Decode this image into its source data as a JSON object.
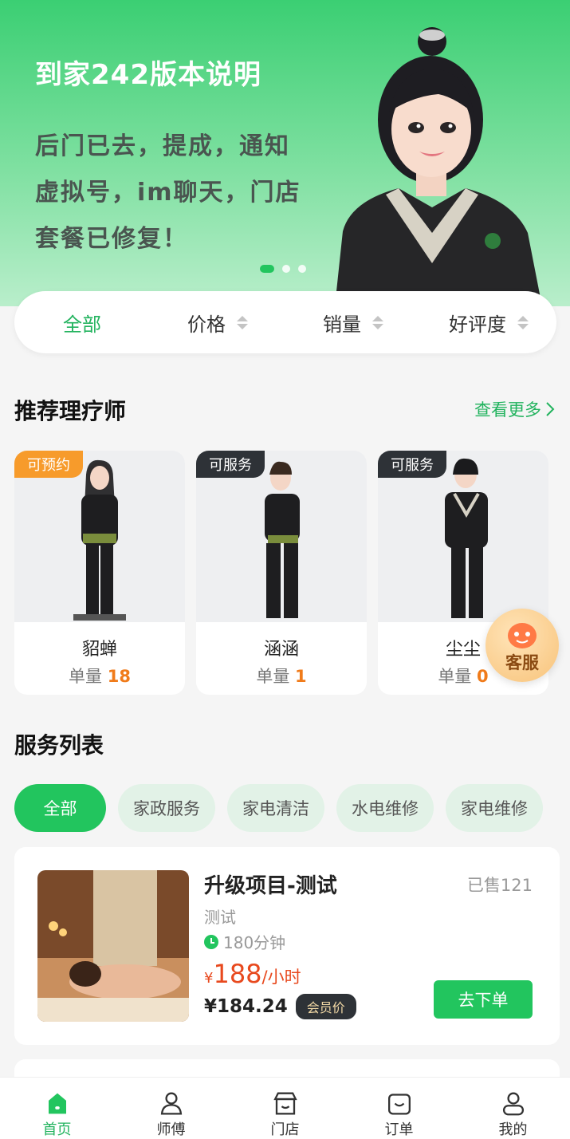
{
  "banner": {
    "title": "到家242版本说明",
    "line1": "后门已去，提成，通知",
    "line2": "虚拟号，im聊天，门店",
    "line3": "套餐已修复！",
    "page_count": 3,
    "active_page": 1
  },
  "sort": {
    "all": "全部",
    "price": "价格",
    "sales": "销量",
    "rating": "好评度"
  },
  "therapists": {
    "title": "推荐理疗师",
    "more": "查看更多",
    "items": [
      {
        "status": "可预约",
        "name": "貂蝉",
        "count_label": "单量",
        "count": "18"
      },
      {
        "status": "可服务",
        "name": "涵涵",
        "count_label": "单量",
        "count": "1"
      },
      {
        "status": "可服务",
        "name": "尘尘",
        "count_label": "单量",
        "count": "0"
      }
    ]
  },
  "customer_service": {
    "label": "客服"
  },
  "services": {
    "title": "服务列表",
    "categories": [
      "全部",
      "家政服务",
      "家电清洁",
      "水电维修",
      "家电维修"
    ],
    "items": [
      {
        "name": "升级项目-测试",
        "sold": "已售121",
        "desc": "测试",
        "duration": "180分钟",
        "currency": "¥",
        "price": "188",
        "unit": "/小时",
        "member_price": "¥184.24",
        "member_tag": "会员价",
        "button": "去下单"
      }
    ]
  },
  "tabbar": {
    "home": "首页",
    "master": "师傅",
    "store": "门店",
    "orders": "订单",
    "mine": "我的"
  },
  "colors": {
    "accent": "#22c55e",
    "price": "#e8491e",
    "badge_orange": "#f79b2b",
    "badge_dark": "#2e3237"
  }
}
